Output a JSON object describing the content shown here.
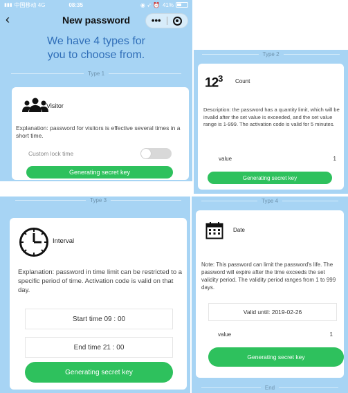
{
  "status_bar": {
    "carrier": "中国移动 4G",
    "time": "08:35",
    "battery": "41%"
  },
  "nav": {
    "back_icon": "chevron-left-icon",
    "title": "New password",
    "more_icon": "more-dots-icon",
    "close_icon": "record-circle-icon"
  },
  "intro": {
    "line1": "We have 4 types for",
    "line2": "you to choose from."
  },
  "type1": {
    "divider": "Type 1",
    "title": "Visitor",
    "icon": "visitor-group-icon",
    "description": "Explanation: password for visitors is effective several times in a short time.",
    "lock_label": "Custom lock time",
    "toggle_on": false,
    "button": "Generating secret key"
  },
  "type2": {
    "divider": "Type 2",
    "icon_text": "123",
    "title": "Count",
    "description": "Description: the password has a quantity limit, which will be invalid after the set value is exceeded, and the set value range is 1-999. The activation code is valid for 5 minutes.",
    "value_label": "value",
    "value": "1",
    "button": "Generating secret key"
  },
  "type3": {
    "divider": "Type 3",
    "title": "Interval",
    "icon": "clock-icon",
    "description": "Explanation: password in time limit can be restricted to a specific period of time. Activation code is valid on that day.",
    "start": "Start time 09 : 00",
    "end": "End time 21 : 00",
    "button": "Generating secret key"
  },
  "type4": {
    "divider": "Type 4",
    "title": "Date",
    "icon": "calendar-icon",
    "description": "Note: This password can limit the password's life. The password will expire after the time exceeds the set validity period. The validity period ranges from 1 to 999 days.",
    "valid_until": "Valid until: 2019-02-26",
    "value_label": "value",
    "value": "1",
    "button": "Generating secret key",
    "end_label": "End"
  },
  "colors": {
    "panel": "#a7d4f4",
    "accent": "#2ec15d",
    "intro_text": "#2f6eb8"
  }
}
